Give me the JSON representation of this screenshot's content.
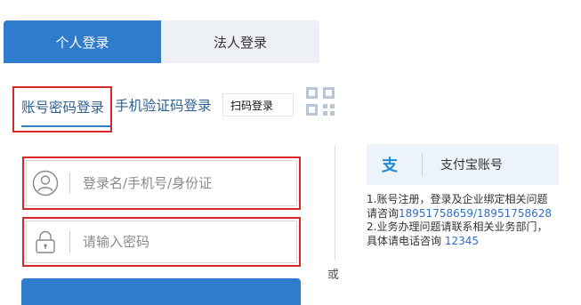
{
  "tabs": {
    "personal": "个人登录",
    "corporate": "法人登录"
  },
  "methods": {
    "account": "账号密码登录",
    "sms": "手机验证码登录",
    "scan": "扫码登录"
  },
  "form": {
    "username_placeholder": "登录名/手机号/身份证",
    "password_placeholder": "请输入密码"
  },
  "or_text": "或",
  "alipay": {
    "label": "支付宝账号",
    "icon": "alipay-icon"
  },
  "notes": {
    "line1": "1.账号注册，登录及企业绑定相关问题",
    "line2_prefix": "请咨询",
    "phones": "18951758659/18951758628",
    "line3": "2.业务办理问题请联系相关业务部门，",
    "line4_prefix": "具体请电话咨询 ",
    "hotline": "12345"
  },
  "colors": {
    "primary": "#2f7ccc",
    "highlight_border": "#d9272c",
    "link": "#2f6fc7"
  }
}
